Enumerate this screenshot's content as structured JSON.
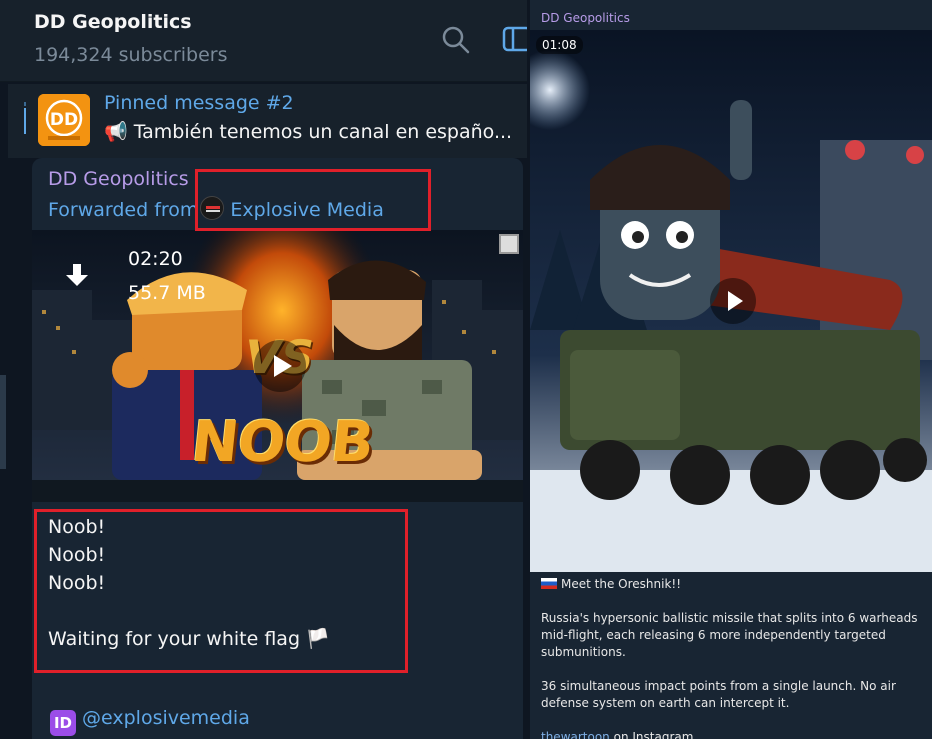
{
  "left": {
    "header": {
      "title": "DD Geopolitics",
      "subscribers": "194,324 subscribers",
      "search_icon": "search-icon",
      "panel_icon": "sidebar-toggle-icon"
    },
    "pinned": {
      "title": "Pinned message #2",
      "text": "📢 También tenemos un canal en españo..."
    },
    "message": {
      "channel": "DD Geopolitics",
      "forwarded_prefix": "Forwarded from",
      "forwarded_source": "Explosive Media",
      "video": {
        "duration": "02:20",
        "size": "55.7 MB",
        "overlay_word": "NOOB",
        "vs_text": "VS"
      },
      "lines": [
        "Noob!",
        "Noob!",
        "Noob!",
        "",
        "Waiting for your white flag 🏳️"
      ],
      "id_badge": "ID",
      "handle": "@explosivemedia"
    }
  },
  "right": {
    "channel": "DD Geopolitics",
    "video_duration": "01:08",
    "text": {
      "p1": "Meet the Oreshnik!!",
      "p2": "Russia's hypersonic ballistic missile that splits into 6 warheads mid-flight, each releasing 6 more independently targeted submunitions.",
      "p3": "36 simultaneous impact points from a single launch. No air defense system on earth can intercept it.",
      "link": "thewartoon",
      "p4_rest": " on Instagram."
    }
  },
  "colors": {
    "accent_blue": "#5fa8e8",
    "channel_purple": "#b79ce8",
    "highlight_red": "#e0202a",
    "bg": "#0e1621",
    "bubble": "#182533"
  }
}
